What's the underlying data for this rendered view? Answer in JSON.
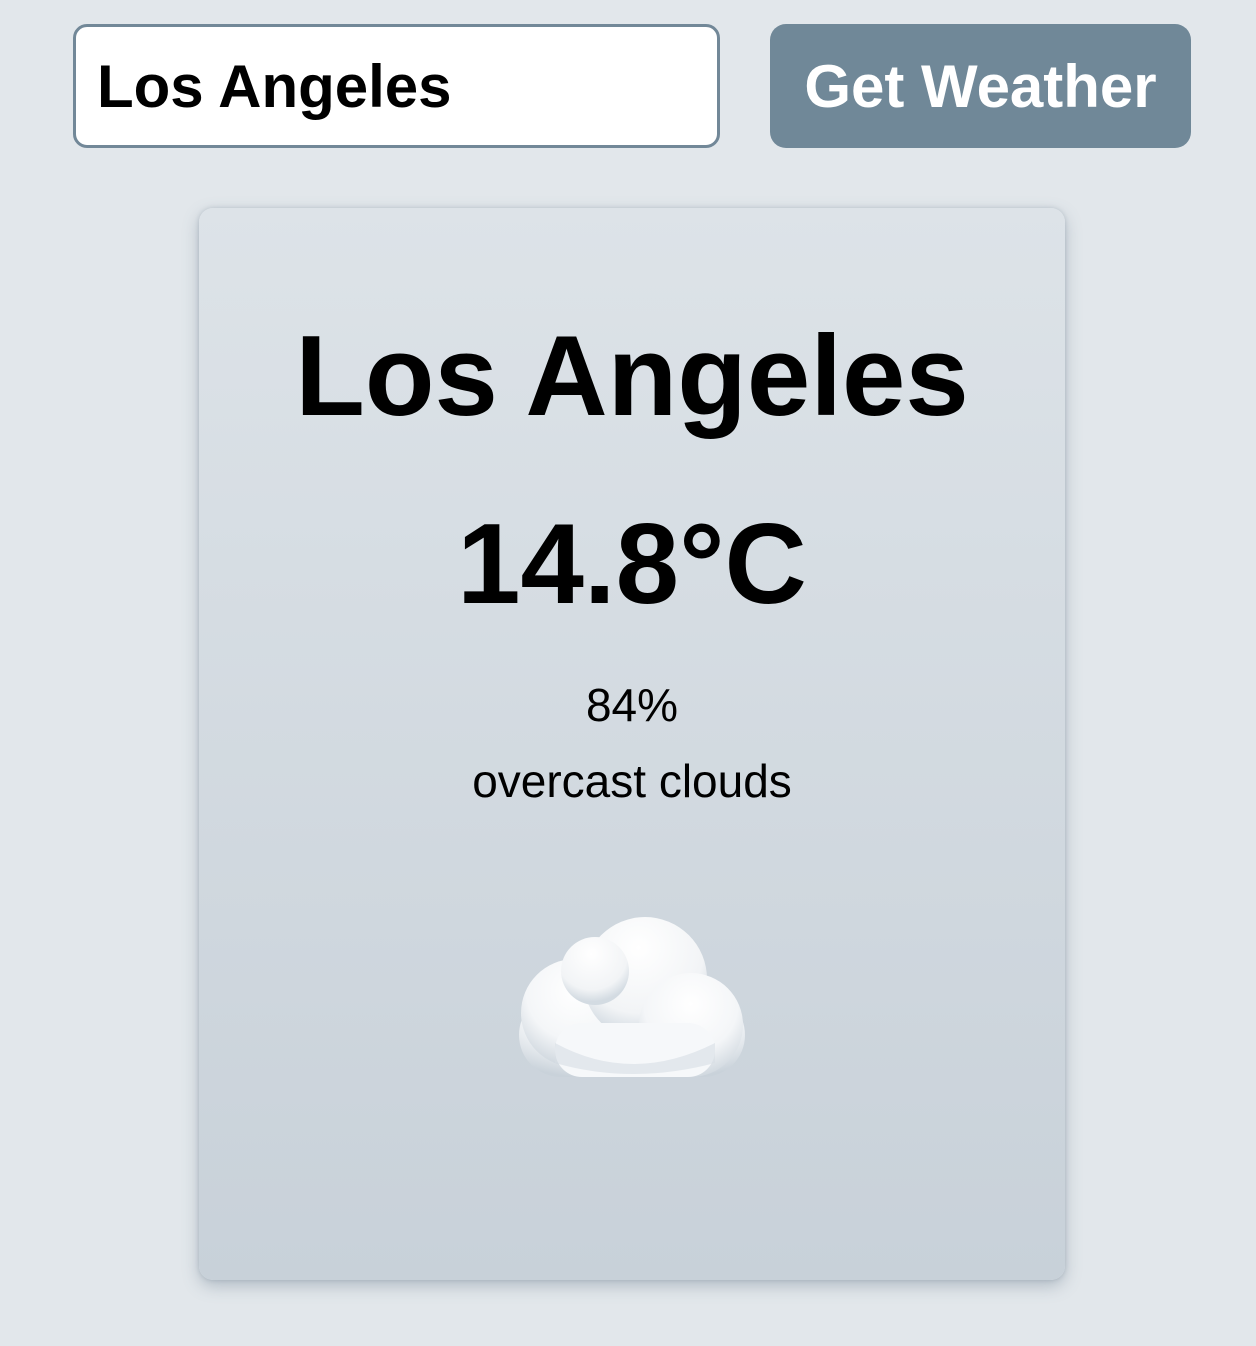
{
  "search": {
    "value": "Los Angeles"
  },
  "button": {
    "label": "Get Weather"
  },
  "weather": {
    "city": "Los Angeles",
    "temperature": "14.8°C",
    "humidity": "84%",
    "description": "overcast clouds",
    "icon": "cloud-icon"
  },
  "colors": {
    "page_background": "#e2e7eb",
    "button_background": "#708898",
    "input_border": "#728898"
  }
}
